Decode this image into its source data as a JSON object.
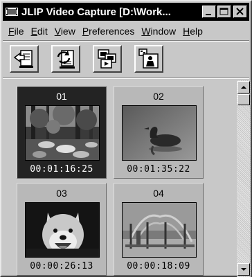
{
  "window": {
    "title": "JLIP Video Capture [D:\\Work...",
    "minimize_icon": "minimize-icon",
    "maximize_icon": "maximize-icon",
    "close_icon": "close-icon"
  },
  "menu": [
    {
      "label": "File",
      "mnemonic": "F",
      "rest": "ile"
    },
    {
      "label": "Edit",
      "mnemonic": "E",
      "rest": "dit"
    },
    {
      "label": "View",
      "mnemonic": "V",
      "rest": "iew"
    },
    {
      "label": "Preferences",
      "mnemonic": "P",
      "rest": "references"
    },
    {
      "label": "Window",
      "mnemonic": "W",
      "rest": "indow"
    },
    {
      "label": "Help",
      "mnemonic": "H",
      "rest": "elp"
    }
  ],
  "toolbar": [
    {
      "icon": "import-arrow-icon"
    },
    {
      "icon": "refresh-document-icon"
    },
    {
      "icon": "video-clips-icon"
    },
    {
      "icon": "person-frame-icon"
    }
  ],
  "thumbnails": [
    {
      "number": "01",
      "timecode": "00:01:16:25",
      "selected": true,
      "scene": "forest-stream"
    },
    {
      "number": "02",
      "timecode": "00:01:35:22",
      "selected": false,
      "scene": "duck-on-water"
    },
    {
      "number": "03",
      "timecode": "00:00:26:13",
      "selected": false,
      "scene": "dog"
    },
    {
      "number": "04",
      "timecode": "00:00:18:09",
      "selected": false,
      "scene": "playground"
    }
  ],
  "colors": {
    "window_bg": "#c8c8c8",
    "titlebar_bg": "#000000",
    "selected_thumb": "#232323"
  }
}
